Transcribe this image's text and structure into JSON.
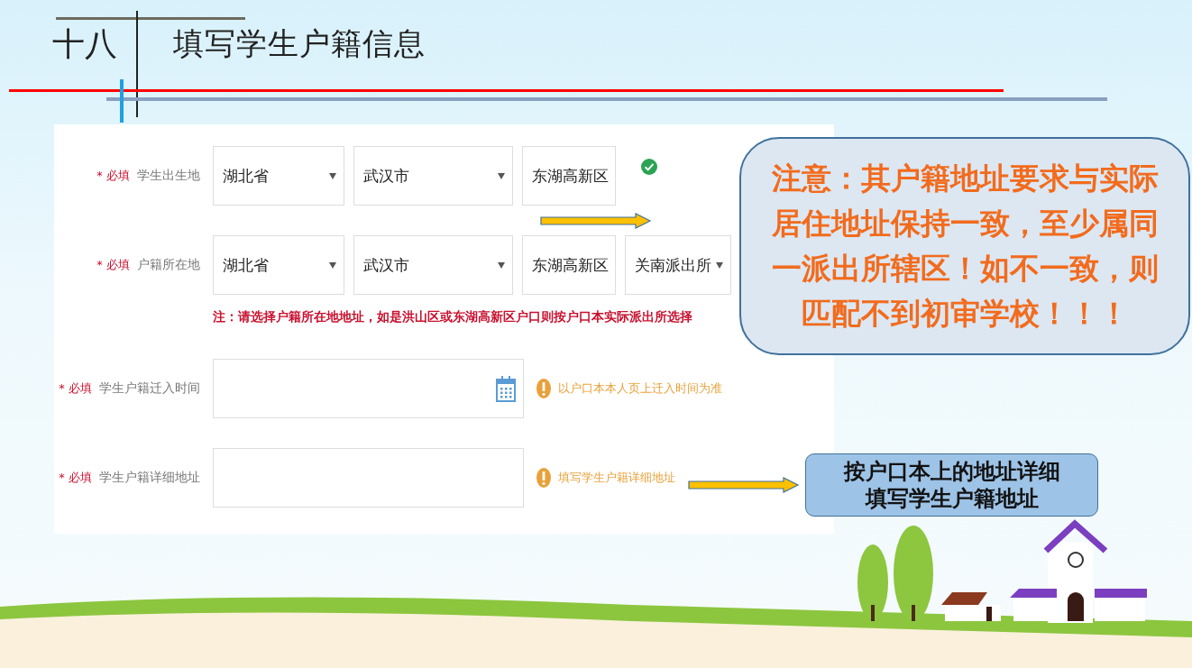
{
  "slide": {
    "number": "十八",
    "title": "填写学生户籍信息"
  },
  "form": {
    "rows": [
      {
        "kind": "selects",
        "required": "* 必填",
        "label": "学生出生地",
        "selects": [
          "湖北省",
          "武汉市",
          "东湖高新区"
        ],
        "valid": true
      },
      {
        "kind": "selects",
        "required": "* 必填",
        "label": "户籍所在地",
        "selects": [
          "湖北省",
          "武汉市",
          "东湖高新区",
          "关南派出所"
        ],
        "note": "注：请选择户籍所在地地址，如是洪山区或东湖高新区户口则按户口本实际派出所选择"
      },
      {
        "kind": "date",
        "required": "* 必填",
        "label": "学生户籍迁入时间",
        "hint": "以户口本本人页上迁入时间为准"
      },
      {
        "kind": "text",
        "required": "* 必填",
        "label": "学生户籍详细地址",
        "hint": "填写学生户籍详细地址"
      }
    ]
  },
  "callouts": [
    {
      "kind": "warning",
      "text": "注意：其户籍地址要求与实际居住地址保持一致，至少属同一派出所辖区！如不一致，则匹配不到初审学校！！！"
    },
    {
      "kind": "tip",
      "text": "按户口本上的地址详细填写学生户籍地址"
    }
  ]
}
